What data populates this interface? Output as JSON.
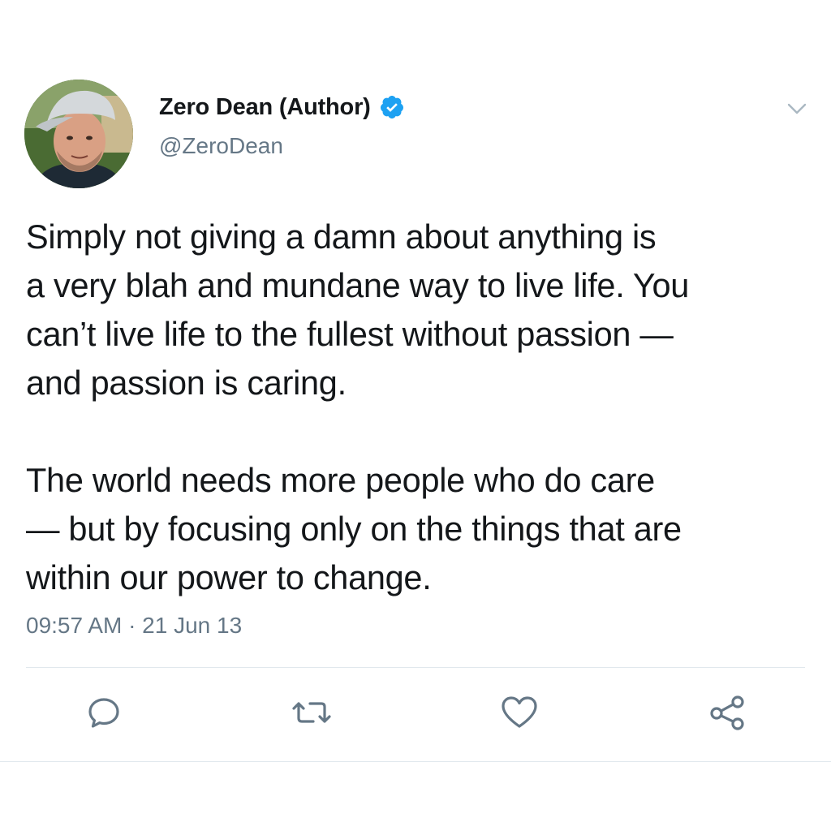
{
  "tweet": {
    "author": {
      "display_name": "Zero Dean (Author)",
      "handle": "@ZeroDean",
      "verified": true,
      "avatar_icon": "author-avatar"
    },
    "text": "Simply not giving a damn about anything is\na very blah and mundane way to live life. You\ncan’t live life to the fullest without passion —\nand passion is caring.\n\nThe world needs more people who do care\n— but by focusing only on the things that are\nwithin our power to change.",
    "timestamp": "09:57 AM · 21 Jun 13",
    "actions": [
      {
        "name": "reply",
        "icon": "reply-icon"
      },
      {
        "name": "retweet",
        "icon": "retweet-icon"
      },
      {
        "name": "like",
        "icon": "heart-icon"
      },
      {
        "name": "share",
        "icon": "share-icon"
      }
    ]
  },
  "colors": {
    "text_primary": "#14171a",
    "text_secondary": "#657786",
    "verified_blue": "#1da1f2",
    "icon_gray": "#657786",
    "divider": "#e1e8ed"
  }
}
